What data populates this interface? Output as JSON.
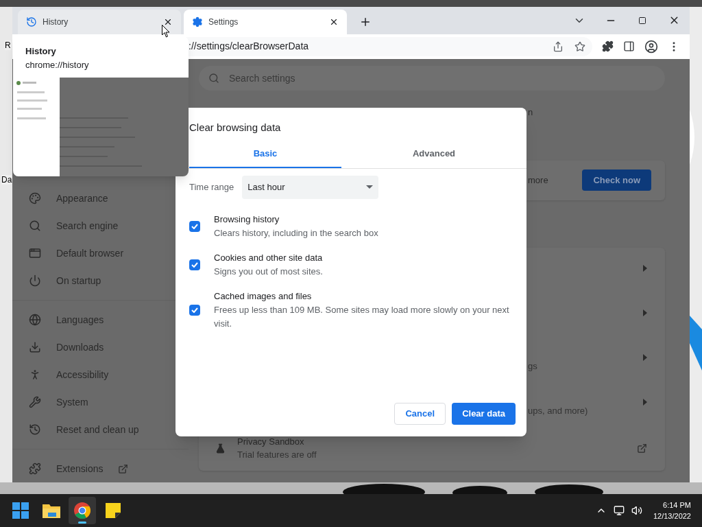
{
  "desktop": {
    "labels": [
      "R",
      "Da"
    ]
  },
  "browser": {
    "tabs": [
      {
        "title": "History",
        "selected": false
      },
      {
        "title": "Settings",
        "selected": true
      }
    ],
    "address": "://settings/clearBrowserData",
    "hover_card": {
      "title": "History",
      "url": "chrome://history"
    },
    "search": {
      "placeholder": "Search settings"
    },
    "sidebar": {
      "groups": [
        [
          {
            "label": "Appearance",
            "external": false
          },
          {
            "label": "Search engine",
            "external": false
          },
          {
            "label": "Default browser",
            "external": false
          },
          {
            "label": "On startup",
            "external": false
          }
        ],
        [
          {
            "label": "Languages",
            "external": false
          },
          {
            "label": "Downloads",
            "external": false
          },
          {
            "label": "Accessibility",
            "external": false
          },
          {
            "label": "System",
            "external": false
          },
          {
            "label": "Reset and clean up",
            "external": false
          }
        ],
        [
          {
            "label": "Extensions",
            "external": true
          }
        ]
      ]
    },
    "main": {
      "heading_fragment": "n",
      "safety_card": {
        "text": "more",
        "button": "Check now"
      },
      "privacy_card": {
        "rows": [
          {
            "kind": "arrow"
          },
          {
            "kind": "arrow"
          },
          {
            "kind": "arrow",
            "subtitle": "gs"
          },
          {
            "kind": "arrow",
            "subtitle": "ups, and more)"
          },
          {
            "kind": "external",
            "title": "Privacy Sandbox",
            "subtitle": "Trial features are off"
          }
        ]
      }
    }
  },
  "dialog": {
    "title": "Clear browsing data",
    "tabs": [
      {
        "label": "Basic",
        "selected": true
      },
      {
        "label": "Advanced",
        "selected": false
      }
    ],
    "time_range": {
      "label": "Time range",
      "value": "Last hour"
    },
    "items": [
      {
        "title": "Browsing history",
        "description": "Clears history, including in the search box",
        "checked": true
      },
      {
        "title": "Cookies and other site data",
        "description": "Signs you out of most sites.",
        "checked": true
      },
      {
        "title": "Cached images and files",
        "description": "Frees up less than 109 MB. Some sites may load more slowly on your next visit.",
        "checked": true
      }
    ],
    "buttons": [
      {
        "label": "Cancel",
        "kind": "secondary"
      },
      {
        "label": "Clear data",
        "kind": "primary"
      }
    ]
  },
  "taskbar": {
    "apps": [
      {
        "kind": "start",
        "selected": false
      },
      {
        "kind": "explorer",
        "selected": false
      },
      {
        "kind": "chrome",
        "selected": true
      },
      {
        "kind": "notes",
        "selected": false
      }
    ],
    "time": "6:14 PM",
    "date": "12/13/2022"
  }
}
